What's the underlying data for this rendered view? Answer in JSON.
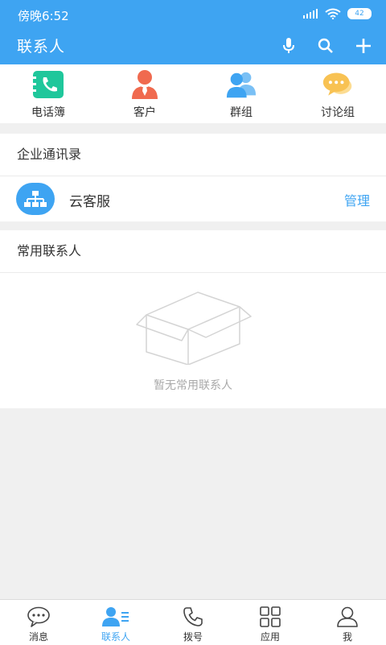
{
  "status": {
    "time": "傍晚6:52",
    "battery": "42"
  },
  "header": {
    "title": "联系人"
  },
  "quick": [
    {
      "label": "电话簿"
    },
    {
      "label": "客户"
    },
    {
      "label": "群组"
    },
    {
      "label": "讨论组"
    }
  ],
  "enterprise": {
    "title": "企业通讯录",
    "item_name": "云客服",
    "manage": "管理"
  },
  "frequent": {
    "title": "常用联系人",
    "empty_text": "暂无常用联系人"
  },
  "tabs": [
    {
      "label": "消息"
    },
    {
      "label": "联系人"
    },
    {
      "label": "拨号"
    },
    {
      "label": "应用"
    },
    {
      "label": "我"
    }
  ],
  "colors": {
    "accent": "#3ea4f2",
    "phonebook": "#1fc79b",
    "customer": "#f06a4f",
    "group": "#3ea4f2",
    "discussion": "#f8c253"
  }
}
